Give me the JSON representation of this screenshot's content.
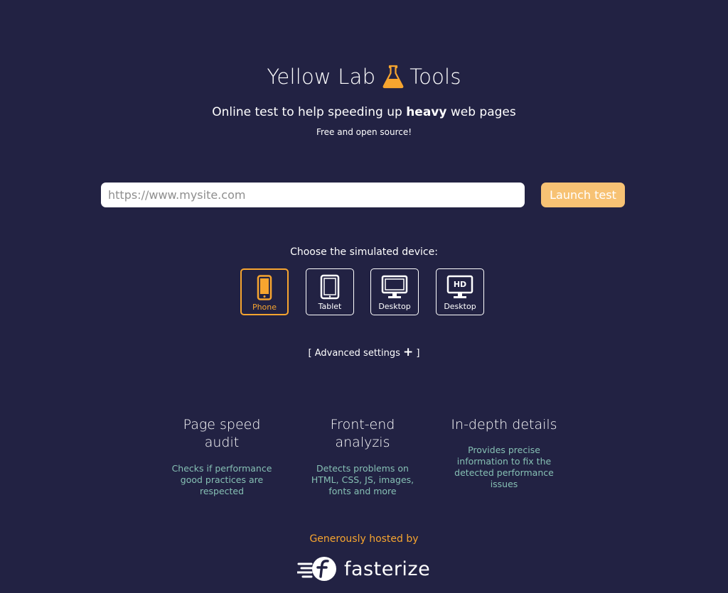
{
  "header": {
    "title_part1": "Yellow Lab",
    "title_part2": "Tools",
    "logo_icon": "flask-icon",
    "subtitle_before": "Online test to help speeding up ",
    "subtitle_bold": "heavy",
    "subtitle_after": " web pages",
    "tagline": "Free and open source!"
  },
  "form": {
    "url_placeholder": "https://www.mysite.com",
    "url_value": "",
    "launch_label": "Launch test"
  },
  "devices": {
    "label": "Choose the simulated device:",
    "selected": "Phone",
    "items": [
      {
        "label": "Phone",
        "icon": "phone-icon"
      },
      {
        "label": "Tablet",
        "icon": "tablet-icon"
      },
      {
        "label": "Desktop",
        "icon": "desktop-icon"
      },
      {
        "label": "Desktop",
        "icon": "hd-desktop-icon",
        "badge": "HD"
      }
    ]
  },
  "advanced": {
    "open_bracket": "[ ",
    "label": "Advanced settings ",
    "plus": "+",
    "close_bracket": " ]"
  },
  "features": [
    {
      "title_line1": "Page speed",
      "title_line2": "audit",
      "desc": [
        "Checks if performance",
        "good practices are",
        "respected"
      ]
    },
    {
      "title_line1": "Front-end",
      "title_line2": "analyzis",
      "desc": [
        "Detects problems on",
        "HTML, CSS, JS, images,",
        "fonts and more"
      ]
    },
    {
      "title_line1": "In-depth details",
      "title_line2": "",
      "desc": [
        "Provides precise",
        "information to fix the",
        "detected performance",
        "issues"
      ]
    }
  ],
  "footer": {
    "hosted_label": "Generously hosted by",
    "sponsor_name": "fasterize",
    "sponsor_icon": "fasterize-logo-icon"
  },
  "colors": {
    "background": "#222243",
    "accent": "#f7a52f",
    "button": "#f7c274",
    "feature_text": "#86c0b4"
  }
}
